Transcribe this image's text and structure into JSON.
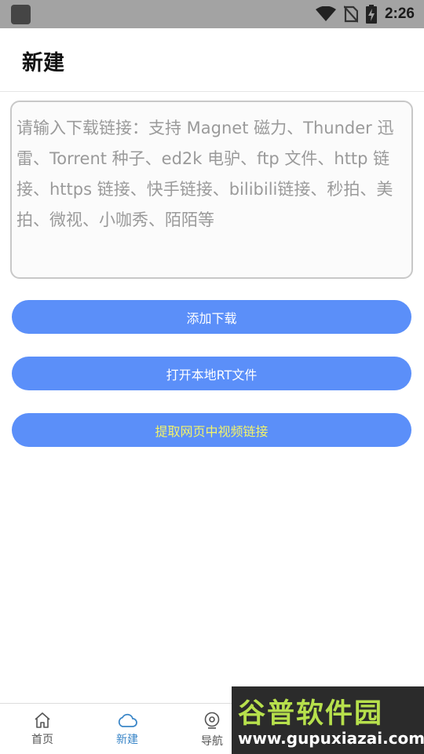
{
  "status_bar": {
    "time": "2:26",
    "icons": [
      "wifi-icon",
      "no-sim-icon",
      "battery-charging-icon"
    ]
  },
  "header": {
    "title": "新建"
  },
  "link_input": {
    "value": "",
    "placeholder": "请输入下载链接：支持 Magnet 磁力、Thunder 迅雷、Torrent 种子、ed2k 电驴、ftp 文件、http 链接、https 链接、快手链接、bilibili链接、秒拍、美拍、微视、小咖秀、陌陌等"
  },
  "actions": {
    "add_download": "添加下载",
    "open_local_rt": "打开本地RT文件",
    "extract_video_links": "提取网页中视频链接"
  },
  "bottom_nav": {
    "items": [
      {
        "label": "首页",
        "icon": "home-icon",
        "active": false
      },
      {
        "label": "新建",
        "icon": "cloud-icon",
        "active": true
      },
      {
        "label": "导航",
        "icon": "compass-icon",
        "active": false
      }
    ]
  },
  "watermark": {
    "title": "谷普软件园",
    "url": "www.gupuxiazai.com"
  },
  "colors": {
    "status_bar": "#a3a3a3",
    "button": "#5b8ff9",
    "button_text": "#ffffff",
    "extract_button_text": "#f3f36a",
    "nav_active": "#3a86c8"
  }
}
